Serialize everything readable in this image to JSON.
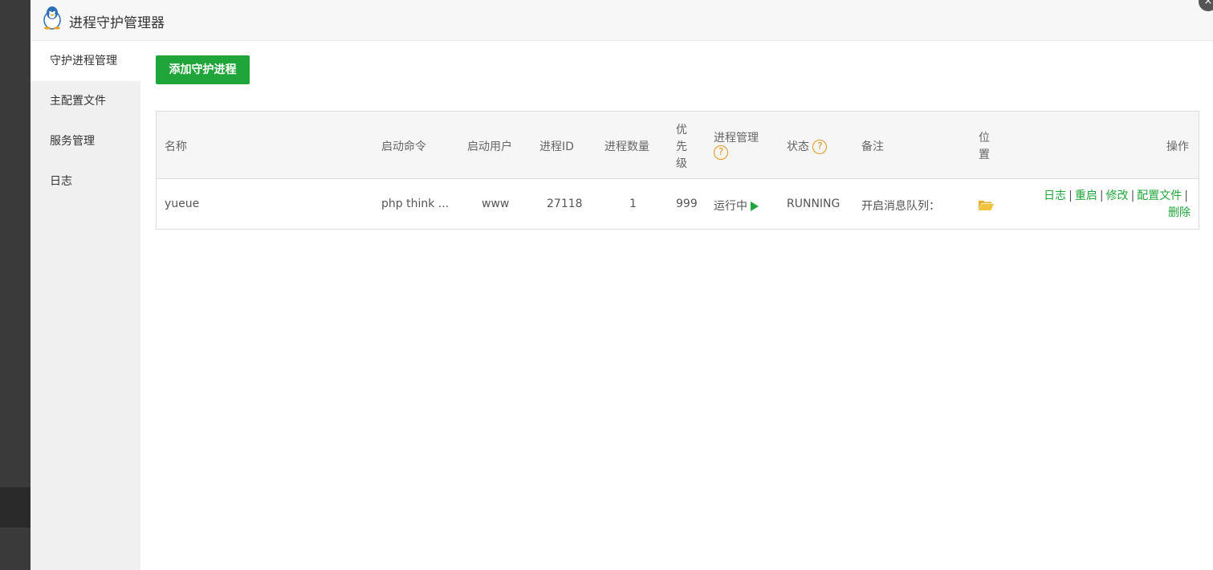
{
  "window": {
    "title": "进程守护管理器",
    "close": "×"
  },
  "sidebar": {
    "items": [
      {
        "label": "守护进程管理",
        "active": true
      },
      {
        "label": "主配置文件",
        "active": false
      },
      {
        "label": "服务管理",
        "active": false
      },
      {
        "label": "日志",
        "active": false
      }
    ]
  },
  "toolbar": {
    "add_label": "添加守护进程"
  },
  "table": {
    "headers": {
      "name": "名称",
      "command": "启动命令",
      "user": "启动用户",
      "pid": "进程ID",
      "count": "进程数量",
      "priority_1": "优",
      "priority_2": "先",
      "priority_3": "级",
      "manage": "进程管理",
      "status": "状态",
      "remark": "备注",
      "location_1": "位",
      "location_2": "置",
      "ops": "操作",
      "help": "?"
    },
    "rows": [
      {
        "name": "yueue",
        "command": "php think ...",
        "user": "www",
        "pid": "27118",
        "count": "1",
        "priority": "999",
        "manage": "运行中",
        "status": "RUNNING",
        "remark": "开启消息队列：",
        "ops": {
          "log": "日志",
          "restart": "重启",
          "edit": "修改",
          "config": "配置文件",
          "delete": "删除",
          "sep": "|"
        }
      }
    ]
  },
  "colors": {
    "accent": "#20a53a",
    "help": "#e8901c",
    "folder": "#f0c33c"
  },
  "icons": {
    "logo": "penguin-icon",
    "folder": "folder-open-icon",
    "play": "play-icon",
    "help": "question-circle-icon"
  }
}
